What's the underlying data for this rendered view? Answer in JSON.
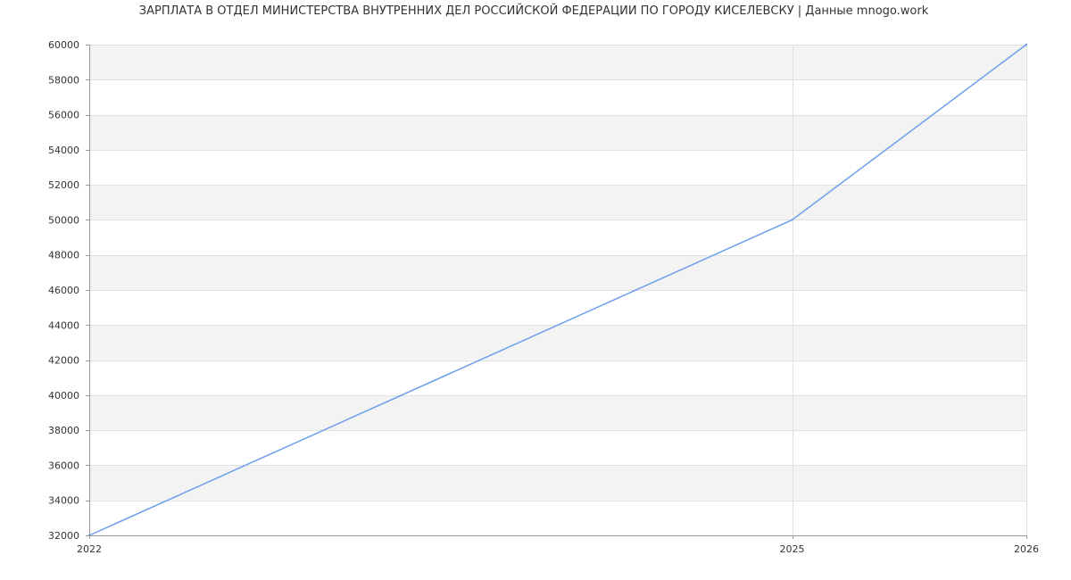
{
  "chart_data": {
    "type": "line",
    "title": "ЗАРПЛАТА В ОТДЕЛ МИНИСТЕРСТВА ВНУТРЕННИХ ДЕЛ РОССИЙСКОЙ ФЕДЕРАЦИИ ПО ГОРОДУ КИСЕЛЕВСКУ | Данные mnogo.work",
    "xlabel": "",
    "ylabel": "",
    "x": [
      2022,
      2025,
      2026
    ],
    "x_tick_labels": [
      "2022",
      "2025",
      "2026"
    ],
    "y_tick_values": [
      32000,
      34000,
      36000,
      38000,
      40000,
      42000,
      44000,
      46000,
      48000,
      50000,
      52000,
      54000,
      56000,
      58000,
      60000
    ],
    "y_tick_labels": [
      "32000",
      "34000",
      "36000",
      "38000",
      "40000",
      "42000",
      "44000",
      "46000",
      "48000",
      "50000",
      "52000",
      "54000",
      "56000",
      "58000",
      "60000"
    ],
    "series": [
      {
        "values": [
          32000,
          50000,
          60000
        ]
      }
    ],
    "xlim": [
      2022,
      2026
    ],
    "ylim": [
      32000,
      60000
    ],
    "grid": true,
    "band_colors": [
      "#f3f3f3",
      "#ffffff"
    ],
    "line_color": "#6d9eeb",
    "grid_color": "#e0e0e0",
    "axis_color": "#999999",
    "text_color": "#333333"
  }
}
